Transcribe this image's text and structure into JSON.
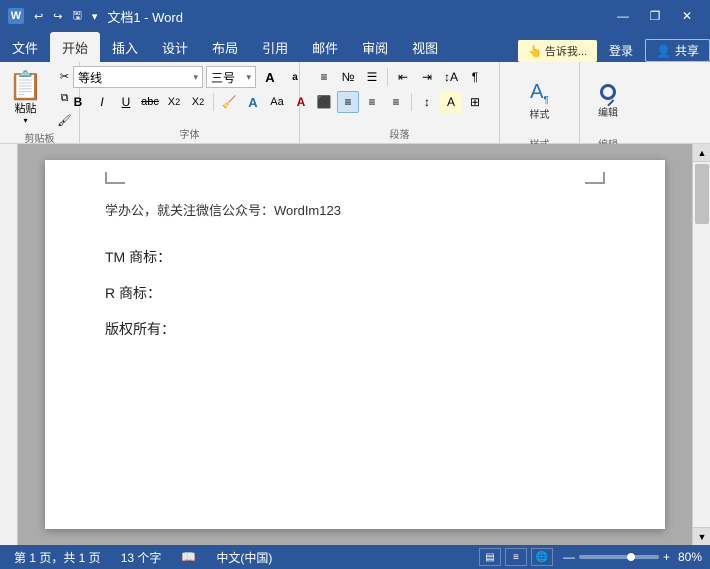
{
  "titleBar": {
    "title": "文档1 - Word",
    "undoLabel": "↩",
    "redoLabel": "↪",
    "autoSaveLabel": "🖫",
    "dropdownLabel": "▾",
    "minimizeLabel": "—",
    "maximizeLabel": "□",
    "closeLabel": "✕",
    "restore": "❐"
  },
  "menuTabs": [
    "文件",
    "开始",
    "插入",
    "设计",
    "布局",
    "引用",
    "邮件",
    "审阅",
    "视图"
  ],
  "activeTab": "开始",
  "notification": "👆 告诉我...",
  "loginLabel": "登录",
  "shareLabel": "共享",
  "ribbon": {
    "groups": {
      "clipboard": "剪贴板",
      "font": "字体",
      "paragraph": "段落",
      "styles": "样式",
      "editing": "编辑"
    },
    "paste": "粘贴",
    "cut": "✂",
    "copy": "⧉",
    "formatPainter": "🖌",
    "fontName": "等线",
    "fontSize": "三号",
    "bold": "B",
    "italic": "I",
    "underline": "U",
    "strikethrough": "abc",
    "subscript": "X₂",
    "superscript": "X²",
    "textEffect": "A",
    "fontColor": "A",
    "highlight": "A",
    "clearFormat": "🧹",
    "fontLarge": "A",
    "fontSmall": "a",
    "changeCaseBtn": "Aa",
    "styleLabel": "样式",
    "editLabel": "编辑",
    "styleIcon": "A¶",
    "editIcon": "✏"
  },
  "document": {
    "subtitle": "学办公，就关注微信公众号：WordIm123",
    "line1": "TM 商标：",
    "line2": "R 商标：",
    "line3": "版权所有："
  },
  "statusBar": {
    "page": "第 1 页，共 1 页",
    "chars": "13 个字",
    "dictIcon": "📖",
    "lang": "中文(中国)",
    "zoom": "80%",
    "zoomMinus": "—",
    "zoomPlus": "+"
  }
}
